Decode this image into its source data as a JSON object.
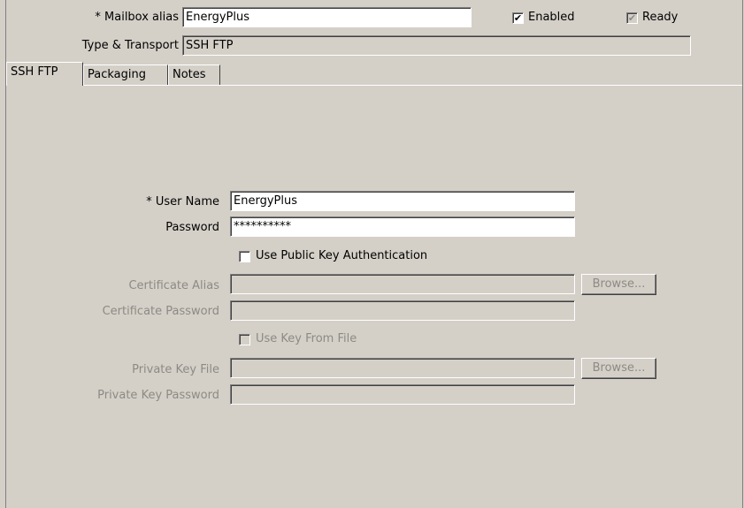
{
  "header": {
    "mailbox_alias_label": "* Mailbox alias",
    "mailbox_alias_value": "EnergyPlus",
    "enabled_label": "Enabled",
    "enabled_checked": true,
    "ready_label": "Ready",
    "ready_checked": true,
    "type_transport_label": "Type & Transport",
    "type_transport_value": "SSH FTP"
  },
  "tabs": [
    {
      "label": "SSH FTP",
      "active": true
    },
    {
      "label": "Packaging",
      "active": false
    },
    {
      "label": "Notes",
      "active": false
    }
  ],
  "form": {
    "user_name_label": "* User Name",
    "user_name_value": "EnergyPlus",
    "password_label": "Password",
    "password_value": "**********",
    "use_public_key_label": "Use Public Key Authentication",
    "use_public_key_checked": false,
    "certificate_alias_label": "Certificate Alias",
    "certificate_alias_value": "",
    "certificate_password_label": "Certificate Password",
    "certificate_password_value": "",
    "use_key_from_file_label": "Use Key From File",
    "use_key_from_file_checked": false,
    "private_key_file_label": "Private Key File",
    "private_key_file_value": "",
    "private_key_password_label": "Private Key Password",
    "private_key_password_value": "",
    "browse_label": "Browse..."
  },
  "glyphs": {
    "check": "✔"
  }
}
